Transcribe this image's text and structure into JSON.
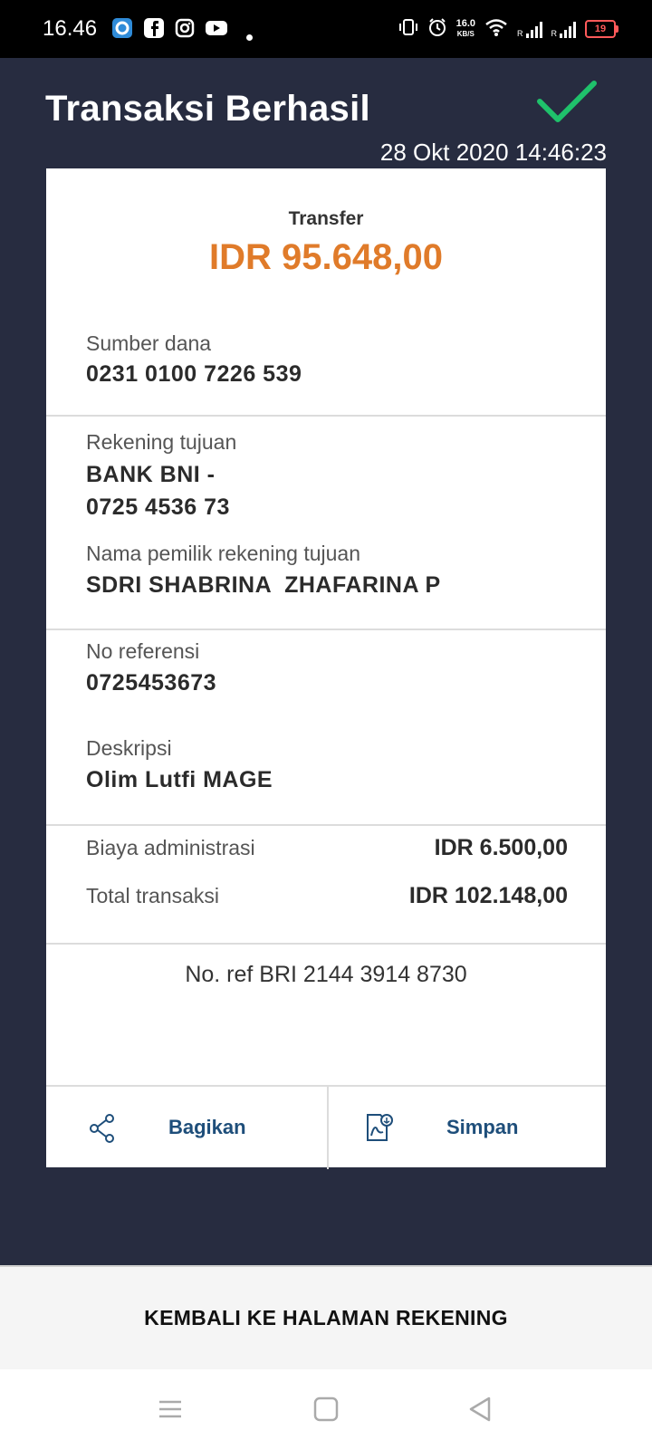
{
  "status_bar": {
    "time": "16.46",
    "net_speed_value": "16.0",
    "net_speed_unit": "KB/S",
    "battery": "19",
    "signal_label_1": "R",
    "signal_label_2": "R",
    "icons": [
      "app-icon",
      "facebook-icon",
      "instagram-icon",
      "youtube-icon",
      "vibrate-icon",
      "alarm-icon",
      "wifi-icon",
      "signal-icon",
      "battery-icon"
    ]
  },
  "header": {
    "title": "Transaksi Berhasil",
    "datetime": "28 Okt 2020 14:46:23",
    "success_color": "#1fc16b"
  },
  "receipt": {
    "type": "Transfer",
    "amount": "IDR 95.648,00",
    "amount_color": "#e07b2a",
    "source_label": "Sumber dana",
    "source_value": "0231 0100 7226 539",
    "dest_label": "Rekening tujuan",
    "dest_bank": "BANK BNI -",
    "dest_account": "0725 4536 73",
    "owner_label": "Nama pemilik rekening tujuan",
    "owner_value": "SDRI SHABRINA  ZHAFARINA P",
    "ref_label": "No referensi",
    "ref_value": "0725453673",
    "desc_label": "Deskripsi",
    "desc_value": "Olim Lutfi MAGE",
    "admin_label": "Biaya administrasi",
    "admin_value": "IDR 6.500,00",
    "total_label": "Total transaksi",
    "total_value": "IDR 102.148,00",
    "bri_ref": "No. ref BRI 2144 3914 8730"
  },
  "actions": {
    "share_label": "Bagikan",
    "save_label": "Simpan",
    "link_color": "#1e4e7a"
  },
  "bottom_button": {
    "label": "KEMBALI KE HALAMAN REKENING"
  }
}
